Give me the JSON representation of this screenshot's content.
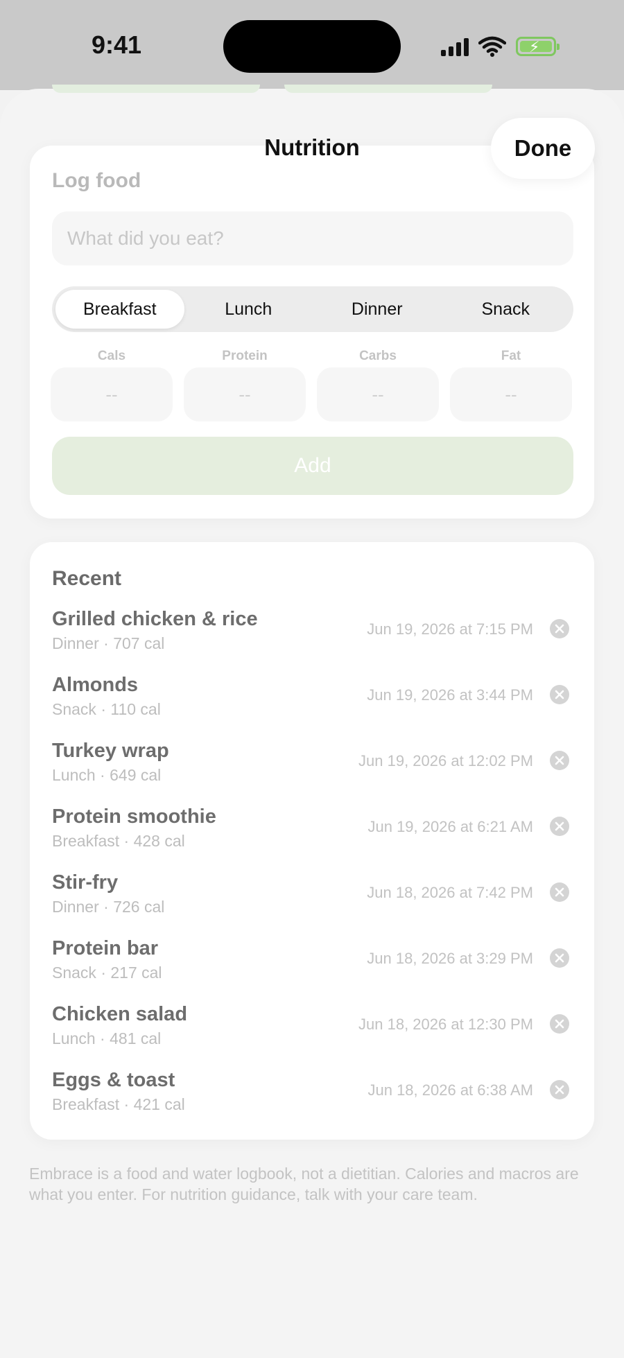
{
  "status_bar": {
    "time": "9:41",
    "icons": [
      "cellular-signal-icon",
      "wifi-icon",
      "battery-charging-icon"
    ],
    "battery_color": "#7fc75f"
  },
  "sheet": {
    "title": "Nutrition",
    "done_label": "Done"
  },
  "log_food": {
    "heading": "Log food",
    "input_placeholder": "What did you eat?",
    "input_value": "",
    "meal_options": [
      "Breakfast",
      "Lunch",
      "Dinner",
      "Snack"
    ],
    "selected_meal": "Breakfast",
    "macros": [
      {
        "label": "Cals",
        "value": "--"
      },
      {
        "label": "Protein",
        "value": "--"
      },
      {
        "label": "Carbs",
        "value": "--"
      },
      {
        "label": "Fat",
        "value": "--"
      }
    ],
    "add_label": "Add",
    "add_button_color": "#e5eede"
  },
  "recent": {
    "heading": "Recent",
    "entries": [
      {
        "name": "Grilled chicken & rice",
        "detail": "Dinner · 707 cal",
        "time": "Jun 19, 2026 at 7:15 PM"
      },
      {
        "name": "Almonds",
        "detail": "Snack · 110 cal",
        "time": "Jun 19, 2026 at 3:44 PM"
      },
      {
        "name": "Turkey wrap",
        "detail": "Lunch · 649 cal",
        "time": "Jun 19, 2026 at 12:02 PM"
      },
      {
        "name": "Protein smoothie",
        "detail": "Breakfast · 428 cal",
        "time": "Jun 19, 2026 at 6:21 AM"
      },
      {
        "name": "Stir-fry",
        "detail": "Dinner · 726 cal",
        "time": "Jun 18, 2026 at 7:42 PM"
      },
      {
        "name": "Protein bar",
        "detail": "Snack · 217 cal",
        "time": "Jun 18, 2026 at 3:29 PM"
      },
      {
        "name": "Chicken salad",
        "detail": "Lunch · 481 cal",
        "time": "Jun 18, 2026 at 12:30 PM"
      },
      {
        "name": "Eggs & toast",
        "detail": "Breakfast · 421 cal",
        "time": "Jun 18, 2026 at 6:38 AM"
      }
    ]
  },
  "disclaimer": "Embrace is a food and water logbook, not a dietitian. Calories and macros are what you enter. For nutrition guidance, talk with your care team."
}
